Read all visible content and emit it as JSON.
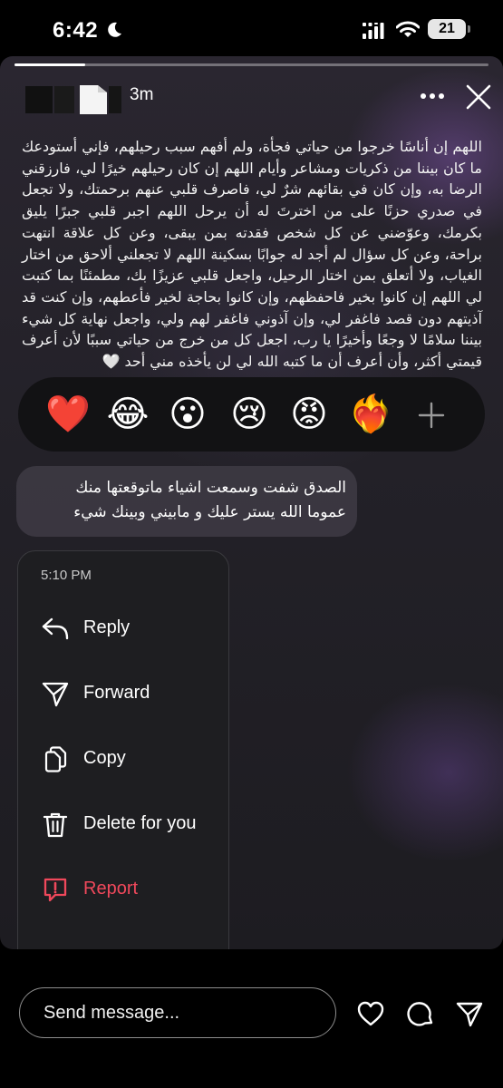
{
  "status_bar": {
    "time": "6:42",
    "battery": "21"
  },
  "story": {
    "progress_fraction": 0.15,
    "posted_ago": "3m",
    "text": "اللهم إن أناسًا خرجوا من حياتي فجأة، ولم أفهم سبب رحيلهم، فإني أستودعك ما كان بيننا من ذكريات ومشاعر وأيام اللهم إن كان رحيلهم خيرًا لي، فارزقني الرضا به، وإن كان في بقائهم شرٌ لي، فاصرف قلبي عنهم برحمتك، ولا تجعل في صدري حزنًا على من اخترتَ له أن يرحل اللهم اجبر قلبي جبرًا يليق بكرمك، وعوّضني عن كل شخص فقدته بمن يبقى، وعن كل علاقة انتهت براحة، وعن كل سؤال لم أجد له جوابًا بسكينة اللهم لا تجعلني ألاحق من اختار الغياب، ولا أتعلق بمن اختار الرحيل، واجعل قلبي عزيزًا بك، مطمئنًا بما كتبت لي اللهم إن كانوا بخير فاحفظهم، وإن كانوا بحاجة لخير فأعطهم، وإن كنت قد آذيتهم دون قصد فاغفر لي، وإن آذوني فاغفر لهم ولي، واجعل نهاية كل شيء بيننا سلامًا لا وجعًا وأخيرًا يا رب، اجعل كل من خرج من حياتي سببًا لأن أعرف قيمتي أكثر، وأن أعرف أن ما كتبه الله لي لن يأخذه مني أحد 🤍"
  },
  "reactions": [
    {
      "emoji": "❤️",
      "name": "heart"
    },
    {
      "emoji": "😂",
      "name": "laugh"
    },
    {
      "emoji": "😮",
      "name": "wow"
    },
    {
      "emoji": "😢",
      "name": "sad"
    },
    {
      "emoji": "😡",
      "name": "angry"
    },
    {
      "emoji": "❤️‍🔥",
      "name": "heart-on-fire"
    }
  ],
  "message": {
    "text": "الصدق شفت وسمعت اشياء ماتوقعتها منك\nعموما الله يستر عليك و مابيني وبينك شيء"
  },
  "menu": {
    "time": "5:10 PM",
    "items": [
      {
        "label": "Reply",
        "icon": "reply-icon"
      },
      {
        "label": "Forward",
        "icon": "forward-icon"
      },
      {
        "label": "Copy",
        "icon": "copy-icon"
      },
      {
        "label": "Delete for you",
        "icon": "trash-icon"
      },
      {
        "label": "Report",
        "icon": "report-icon"
      }
    ]
  },
  "bottom_bar": {
    "placeholder": "Send message..."
  },
  "colors": {
    "danger": "#f0485b",
    "menu_bg": "#1e1e21"
  }
}
